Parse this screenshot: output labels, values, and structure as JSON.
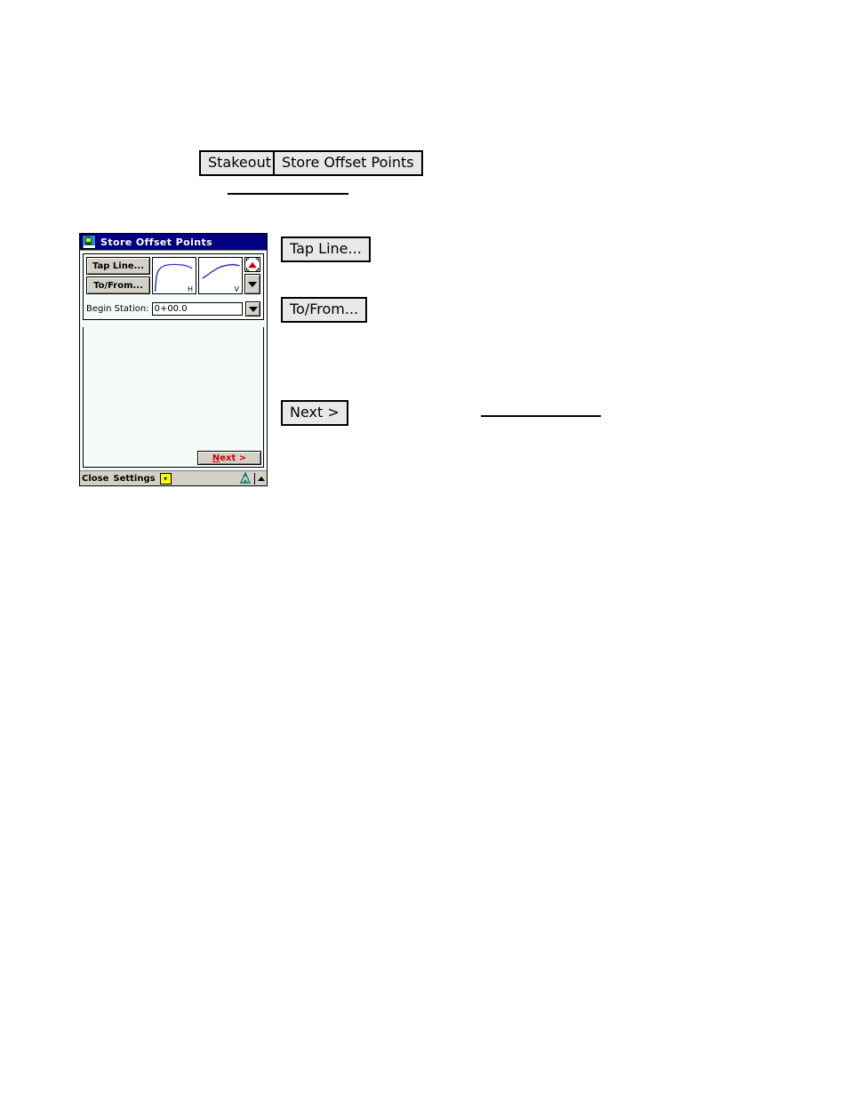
{
  "doc_callouts": {
    "menu_path": [
      {
        "label": "Stakeout",
        "name": "callout-stakeout"
      },
      {
        "label": "Store Offset Points",
        "name": "callout-store-offset-points"
      }
    ],
    "field_labels": [
      {
        "label": "Tap Line...",
        "name": "callout-tap-line"
      },
      {
        "label": "To/From...",
        "name": "callout-to-from"
      },
      {
        "label": "Next >",
        "name": "callout-next"
      }
    ]
  },
  "device": {
    "titlebar": {
      "title": "Store Offset Points",
      "icon": "app-icon"
    },
    "line_panel": {
      "buttons": [
        {
          "label": "Tap Line...",
          "name": "tap-line-button"
        },
        {
          "label": "To/From...",
          "name": "to-from-button"
        }
      ],
      "thumbnails": [
        {
          "label": "H",
          "name": "horizontal-alignment-thumbnail"
        },
        {
          "label": "V",
          "name": "vertical-alignment-thumbnail"
        }
      ],
      "zoom_extents_icon": "zoom-extents-icon",
      "dropdown_icon": "chevron-down-icon"
    },
    "station": {
      "label": "Begin Station:",
      "value": "0+00.0",
      "placeholder": "0+00.0",
      "dropdown_icon": "chevron-down-icon"
    },
    "next_button": {
      "accel": "N",
      "rest": "ext >",
      "full_label": "Next >"
    },
    "statusbar": {
      "close_label": "Close",
      "settings_label": "Settings",
      "settings_icon": "settings-star-icon",
      "instrument_icon": "total-station-icon",
      "up_icon": "chevron-up-icon"
    }
  },
  "colors": {
    "titlebar_bg": "#000080",
    "titlebar_text": "#ffffff",
    "window_face": "#d4d0c8",
    "client_bg": "#f5fbf8",
    "accent_red": "#cc0000",
    "curve_blue": "#3333cc",
    "settings_yellow": "#ffff00"
  },
  "chart_data": [
    {
      "type": "line",
      "title": "H",
      "name": "horizontal-alignment-preview",
      "x": [
        0,
        2,
        5,
        10,
        18,
        28,
        38,
        48,
        58,
        66,
        72
      ],
      "y": [
        72,
        40,
        26,
        18,
        13,
        11,
        11,
        12,
        14,
        17,
        20
      ],
      "xlabel": "",
      "ylabel": "",
      "xlim": [
        0,
        76
      ],
      "ylim": [
        0,
        80
      ],
      "grid": false,
      "legend": false,
      "series_color": "#3333cc"
    },
    {
      "type": "line",
      "title": "V",
      "name": "vertical-alignment-preview",
      "x": [
        0,
        8,
        16,
        24,
        34,
        44,
        54,
        62,
        70,
        74
      ],
      "y": [
        44,
        40,
        35,
        30,
        26,
        24,
        23,
        23,
        24,
        24
      ],
      "xlabel": "",
      "ylabel": "",
      "xlim": [
        0,
        78
      ],
      "ylim": [
        0,
        52
      ],
      "grid": false,
      "legend": false,
      "series_color": "#3333cc"
    }
  ]
}
